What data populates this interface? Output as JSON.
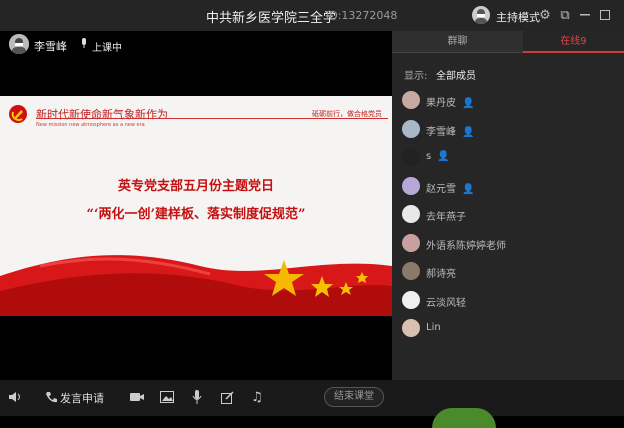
{
  "window": {
    "title": "中共新乡医学院三全学",
    "id_label": "ID:13272048",
    "host_mode_label": "主持模式"
  },
  "stage": {
    "user_name": "李雪峰",
    "status": "上课中"
  },
  "slide": {
    "headline": "新时代新使命新气象新作为",
    "subheadline": "New mission new atmosphere as a new era",
    "right_motto": "砥砺前行，做合格党员",
    "line1": "英专党支部五月份主题党日",
    "line2": "“‘两化一创’建样板、落实制度促规范”"
  },
  "toolbar": {
    "apply_label": "发言申请",
    "end_label": "结束课堂"
  },
  "panel": {
    "tabs": [
      "群聊",
      "在线9"
    ],
    "show_label": "显示:",
    "show_value": "全部成员",
    "members": [
      {
        "name": "果丹皮",
        "role": "teacher"
      },
      {
        "name": "李雪峰",
        "role": "host"
      },
      {
        "name": "s",
        "role": "host"
      },
      {
        "name": "赵元雪",
        "role": "host"
      },
      {
        "name": "去年燕子",
        "role": ""
      },
      {
        "name": "外语系陈婷婷老师",
        "role": ""
      },
      {
        "name": "郝诗亮",
        "role": ""
      },
      {
        "name": "云淡风轻",
        "role": ""
      },
      {
        "name": "Lin",
        "role": ""
      }
    ]
  },
  "colors": {
    "accent_red": "#d23a3a",
    "slide_red": "#c41010",
    "panel_bg": "#262626"
  }
}
